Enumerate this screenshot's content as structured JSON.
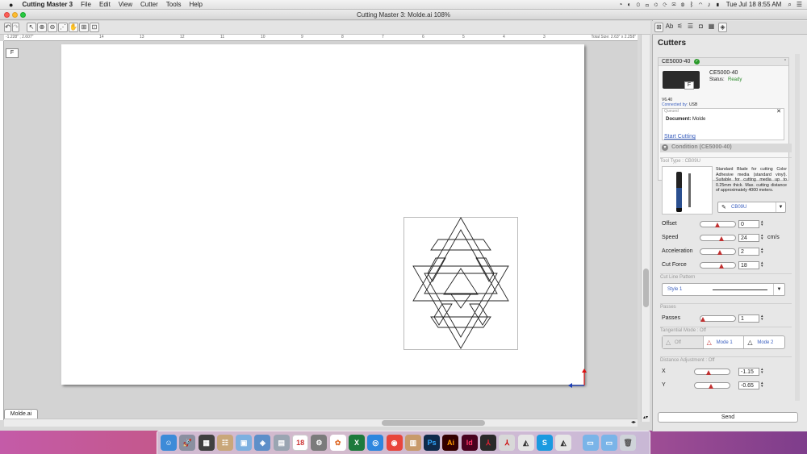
{
  "menubar": {
    "app_name": "Cutting Master 3",
    "menus": [
      "File",
      "Edit",
      "View",
      "Cutter",
      "Tools",
      "Help"
    ],
    "clock": "Tue Jul 18  8:55 AM"
  },
  "window": {
    "title": "Cutting Master 3: Molde.ai 108%"
  },
  "ruler": {
    "origin_label": "-1.228\" ; 2.607\"",
    "total_size": "Total Size: 2.63\" x 2.258\"",
    "ticks": [
      "14",
      "13",
      "12",
      "11",
      "10",
      "9",
      "8",
      "7",
      "6",
      "5",
      "4",
      "3",
      "2",
      "1",
      "0"
    ]
  },
  "document": {
    "tab": "Molde.ai"
  },
  "panel": {
    "title": "Cutters",
    "cutter_name": "CE5000-40",
    "cutter_model": "CE5000-40",
    "status_label": "Status:",
    "status_value": "Ready",
    "version": "V6.40",
    "connected_label": "Connected by:",
    "connected_value": "USB",
    "queued_label": "Queued",
    "document_label": "Document:",
    "document_value": "Molde",
    "start_cutting": "Start Cutting",
    "condition_header": "Condition (CE5000-40)",
    "tool_type": "Tool Type : CB09U",
    "tool_description": "Standard Blade for cutting Color Adhesive media (standard vinyl). Suitable for cutting media up to 0.25mm thick. Max. cutting distance of approximately 4000 meters.",
    "tool_select": "CB09U",
    "params": [
      {
        "label": "Offset",
        "value": "0",
        "unit": "",
        "level": 0.45
      },
      {
        "label": "Speed",
        "value": "24",
        "unit": "cm/s",
        "level": 0.55
      },
      {
        "label": "Acceleration",
        "value": "2",
        "unit": "",
        "level": 0.5
      },
      {
        "label": "Cut Force",
        "value": "18",
        "unit": "",
        "level": 0.55
      }
    ],
    "cut_line_pattern": "Cut Line Pattern",
    "style_value": "Style 1",
    "passes_header": "Passes",
    "passes_label": "Passes",
    "passes_value": "1",
    "tangential_header": "Tangential Mode : Off",
    "tangential_options": [
      "Off",
      "Mode 1",
      "Mode 2"
    ],
    "distance_header": "Distance Adjustment : Off",
    "x_label": "X",
    "x_value": "-1.15",
    "y_label": "Y",
    "y_value": "-0.65",
    "send": "Send"
  },
  "colors": {
    "ready": "#2a8a2a",
    "highlight": "#d01a1a",
    "link": "#3a5fbf"
  }
}
